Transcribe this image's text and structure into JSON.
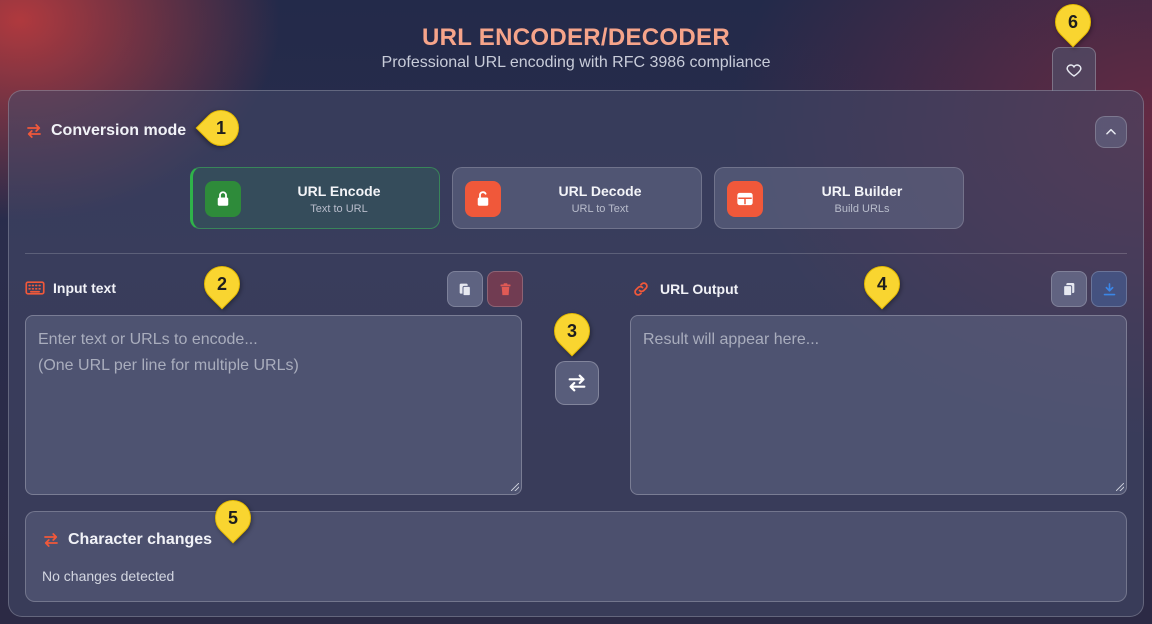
{
  "header": {
    "title": "URL ENCODER/DECODER",
    "subtitle": "Professional URL encoding with RFC 3986 compliance",
    "favorite_icon": "heart-icon"
  },
  "mode": {
    "heading": "Conversion mode",
    "heading_icon": "swap-arrows-icon",
    "collapse_icon": "chevron-up-icon",
    "cards": [
      {
        "label": "URL Encode",
        "sub": "Text to URL",
        "icon": "lock-icon",
        "color": "#2e8b3a",
        "active": true
      },
      {
        "label": "URL Decode",
        "sub": "URL to Text",
        "icon": "unlock-icon",
        "color": "#f0583a",
        "active": false
      },
      {
        "label": "URL Builder",
        "sub": "Build URLs",
        "icon": "table-icon",
        "color": "#f0583a",
        "active": false
      }
    ]
  },
  "input": {
    "heading": "Input text",
    "heading_icon": "keyboard-icon",
    "placeholder": "Enter text or URLs to encode...\n(One URL per line for multiple URLs)",
    "value": "",
    "paste_icon": "clipboard-icon",
    "clear_icon": "trash-icon"
  },
  "output": {
    "heading": "URL Output",
    "heading_icon": "link-icon",
    "placeholder": "Result will appear here...",
    "value": "",
    "copy_icon": "copy-icon",
    "download_icon": "download-icon"
  },
  "swap": {
    "icon": "swap-arrows-icon"
  },
  "changes": {
    "heading": "Character changes",
    "heading_icon": "swap-arrows-icon",
    "text": "No changes detected"
  },
  "markers": [
    "1",
    "2",
    "3",
    "4",
    "5",
    "6"
  ],
  "colors": {
    "accent": "#f0583a",
    "title": "#f6a48a",
    "encode_green": "#2e8b3a",
    "marker_yellow": "#f9d530",
    "download_blue": "#3b86e6"
  }
}
